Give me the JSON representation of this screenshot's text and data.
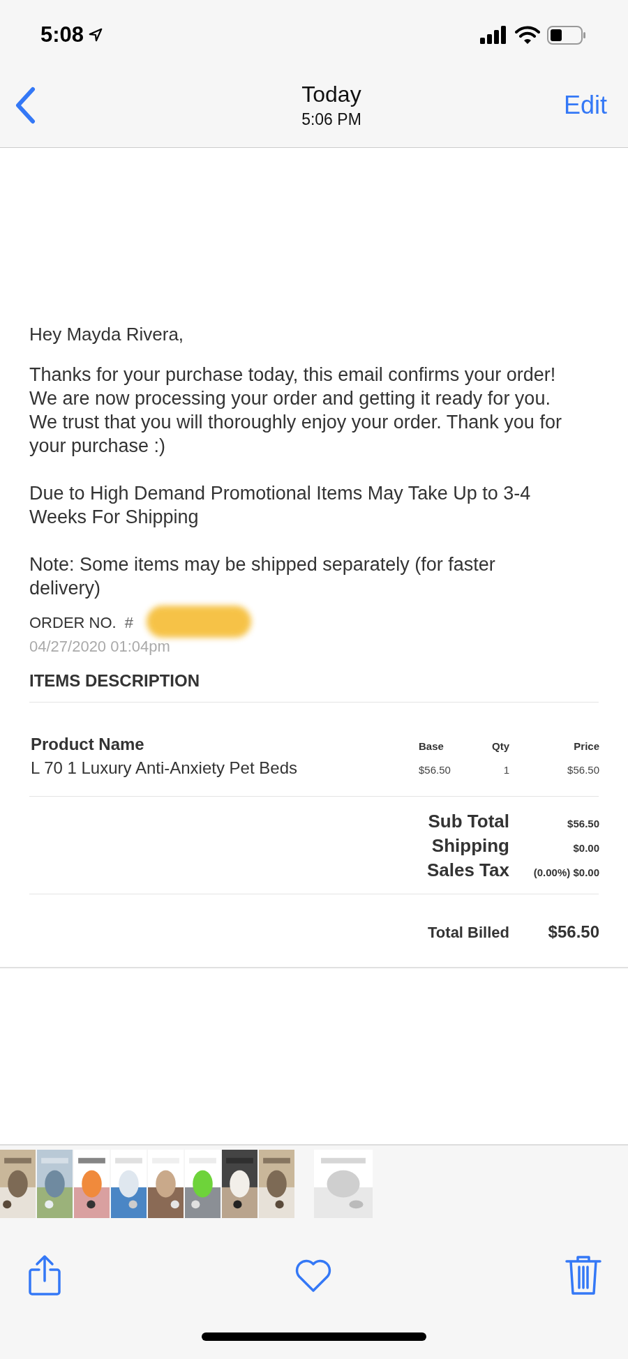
{
  "status_bar": {
    "time": "5:08"
  },
  "nav": {
    "title": "Today",
    "subtitle": "5:06 PM",
    "edit": "Edit"
  },
  "email": {
    "greeting": "Hey Mayda Rivera,",
    "paragraphs": [
      [
        "Thanks for your purchase today, this email confirms your order!",
        "We are now processing your order and getting it ready for you. We trust that you will thoroughly enjoy your order. Thank you for your purchase :)"
      ],
      [
        "Due to High Demand Promotional Items May Take Up to 3-4 Weeks For Shipping"
      ],
      [
        "Note: Some items may be shipped separately (for faster delivery)"
      ]
    ],
    "order_label": "ORDER NO.",
    "order_number": "#",
    "order_date": "04/27/2020 01:04pm",
    "section_title": "ITEMS DESCRIPTION",
    "table": {
      "columns": [
        "Product Name",
        "Base",
        "Qty",
        "Price"
      ],
      "rows": [
        [
          "L 70 1 Luxury Anti-Anxiety Pet Beds",
          "$56.50",
          "1",
          "$56.50"
        ]
      ]
    },
    "totals": [
      {
        "label": "Sub Total",
        "value": "$56.50"
      },
      {
        "label": "Shipping",
        "value": "$0.00"
      },
      {
        "label": "Sales Tax",
        "value": "(0.00%) $0.00"
      }
    ],
    "total_billed": {
      "label": "Total Billed",
      "value": "$56.50"
    }
  },
  "thumbnails": [
    {
      "kind": "picture",
      "selected": false
    },
    {
      "kind": "picture",
      "selected": false
    },
    {
      "kind": "picture",
      "selected": false
    },
    {
      "kind": "picture",
      "selected": false
    },
    {
      "kind": "picture",
      "selected": false
    },
    {
      "kind": "picture",
      "selected": false
    },
    {
      "kind": "picture",
      "selected": false
    },
    {
      "kind": "picture",
      "selected": false
    },
    {
      "kind": "picture",
      "selected": true
    }
  ]
}
